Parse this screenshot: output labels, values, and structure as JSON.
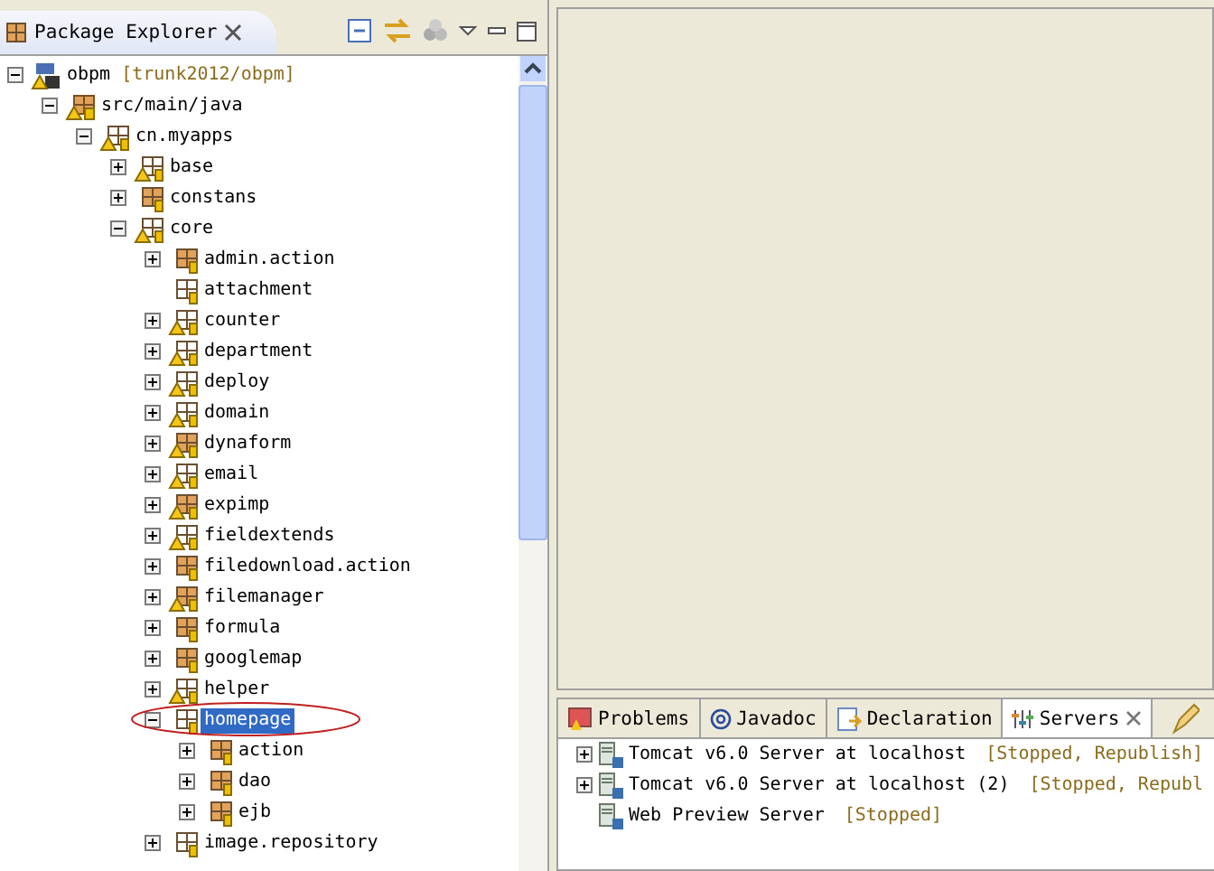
{
  "package_explorer": {
    "title": "Package Explorer",
    "tree": [
      {
        "label": "obpm",
        "decoration": "[trunk2012/obpm]",
        "kind": "project",
        "warning": true,
        "expanded": true,
        "selected": false,
        "children": [
          {
            "label": "src/main/java",
            "kind": "source-folder",
            "warning": true,
            "expanded": true,
            "selected": false,
            "children": [
              {
                "label": "cn.myapps",
                "kind": "package-hollow",
                "warning": true,
                "expanded": true,
                "selected": false,
                "children": [
                  {
                    "label": "base",
                    "kind": "package-hollow",
                    "warning": true,
                    "expanded": false,
                    "selected": false
                  },
                  {
                    "label": "constans",
                    "kind": "package",
                    "warning": false,
                    "expanded": false,
                    "selected": false
                  },
                  {
                    "label": "core",
                    "kind": "package-hollow",
                    "warning": true,
                    "expanded": true,
                    "selected": false,
                    "children": [
                      {
                        "label": "admin.action",
                        "kind": "package",
                        "warning": false,
                        "expanded": false,
                        "selected": false
                      },
                      {
                        "label": "attachment",
                        "kind": "package-hollow",
                        "warning": false,
                        "selected": false
                      },
                      {
                        "label": "counter",
                        "kind": "package-hollow",
                        "warning": true,
                        "expanded": false,
                        "selected": false
                      },
                      {
                        "label": "department",
                        "kind": "package-hollow",
                        "warning": true,
                        "expanded": false,
                        "selected": false
                      },
                      {
                        "label": "deploy",
                        "kind": "package-hollow",
                        "warning": true,
                        "expanded": false,
                        "selected": false
                      },
                      {
                        "label": "domain",
                        "kind": "package-hollow",
                        "warning": true,
                        "expanded": false,
                        "selected": false
                      },
                      {
                        "label": "dynaform",
                        "kind": "package",
                        "warning": true,
                        "expanded": false,
                        "selected": false
                      },
                      {
                        "label": "email",
                        "kind": "package-hollow",
                        "warning": true,
                        "expanded": false,
                        "selected": false
                      },
                      {
                        "label": "expimp",
                        "kind": "package",
                        "warning": true,
                        "expanded": false,
                        "selected": false
                      },
                      {
                        "label": "fieldextends",
                        "kind": "package-hollow",
                        "warning": true,
                        "expanded": false,
                        "selected": false
                      },
                      {
                        "label": "filedownload.action",
                        "kind": "package",
                        "warning": false,
                        "expanded": false,
                        "selected": false
                      },
                      {
                        "label": "filemanager",
                        "kind": "package",
                        "warning": true,
                        "expanded": false,
                        "selected": false
                      },
                      {
                        "label": "formula",
                        "kind": "package",
                        "warning": false,
                        "expanded": false,
                        "selected": false
                      },
                      {
                        "label": "googlemap",
                        "kind": "package",
                        "warning": false,
                        "expanded": false,
                        "selected": false
                      },
                      {
                        "label": "helper",
                        "kind": "package-hollow",
                        "warning": true,
                        "expanded": false,
                        "selected": false
                      },
                      {
                        "label": "homepage",
                        "kind": "package-hollow",
                        "warning": false,
                        "expanded": true,
                        "selected": true,
                        "circled": true,
                        "children": [
                          {
                            "label": "action",
                            "kind": "package",
                            "warning": false,
                            "expanded": false,
                            "selected": false
                          },
                          {
                            "label": "dao",
                            "kind": "package",
                            "warning": false,
                            "expanded": false,
                            "selected": false
                          },
                          {
                            "label": "ejb",
                            "kind": "package",
                            "warning": false,
                            "expanded": false,
                            "selected": false
                          }
                        ]
                      },
                      {
                        "label": "image.repository",
                        "kind": "package-hollow",
                        "warning": false,
                        "expanded": false,
                        "selected": false
                      }
                    ]
                  }
                ]
              }
            ]
          }
        ]
      }
    ]
  },
  "bottom_panel": {
    "tabs": [
      {
        "label": "Problems",
        "kind": "problems",
        "selected": false
      },
      {
        "label": "Javadoc",
        "kind": "javadoc",
        "selected": false
      },
      {
        "label": "Declaration",
        "kind": "declaration",
        "selected": false
      },
      {
        "label": "Servers",
        "kind": "servers",
        "selected": true
      }
    ],
    "servers": [
      {
        "name": "Tomcat v6.0 Server at localhost",
        "status": "[Stopped, Republish]",
        "expanded": false
      },
      {
        "name": "Tomcat v6.0 Server at localhost (2)",
        "status": "[Stopped, Republ",
        "expanded": false
      },
      {
        "name": "Web Preview Server",
        "status": "[Stopped]"
      }
    ]
  }
}
